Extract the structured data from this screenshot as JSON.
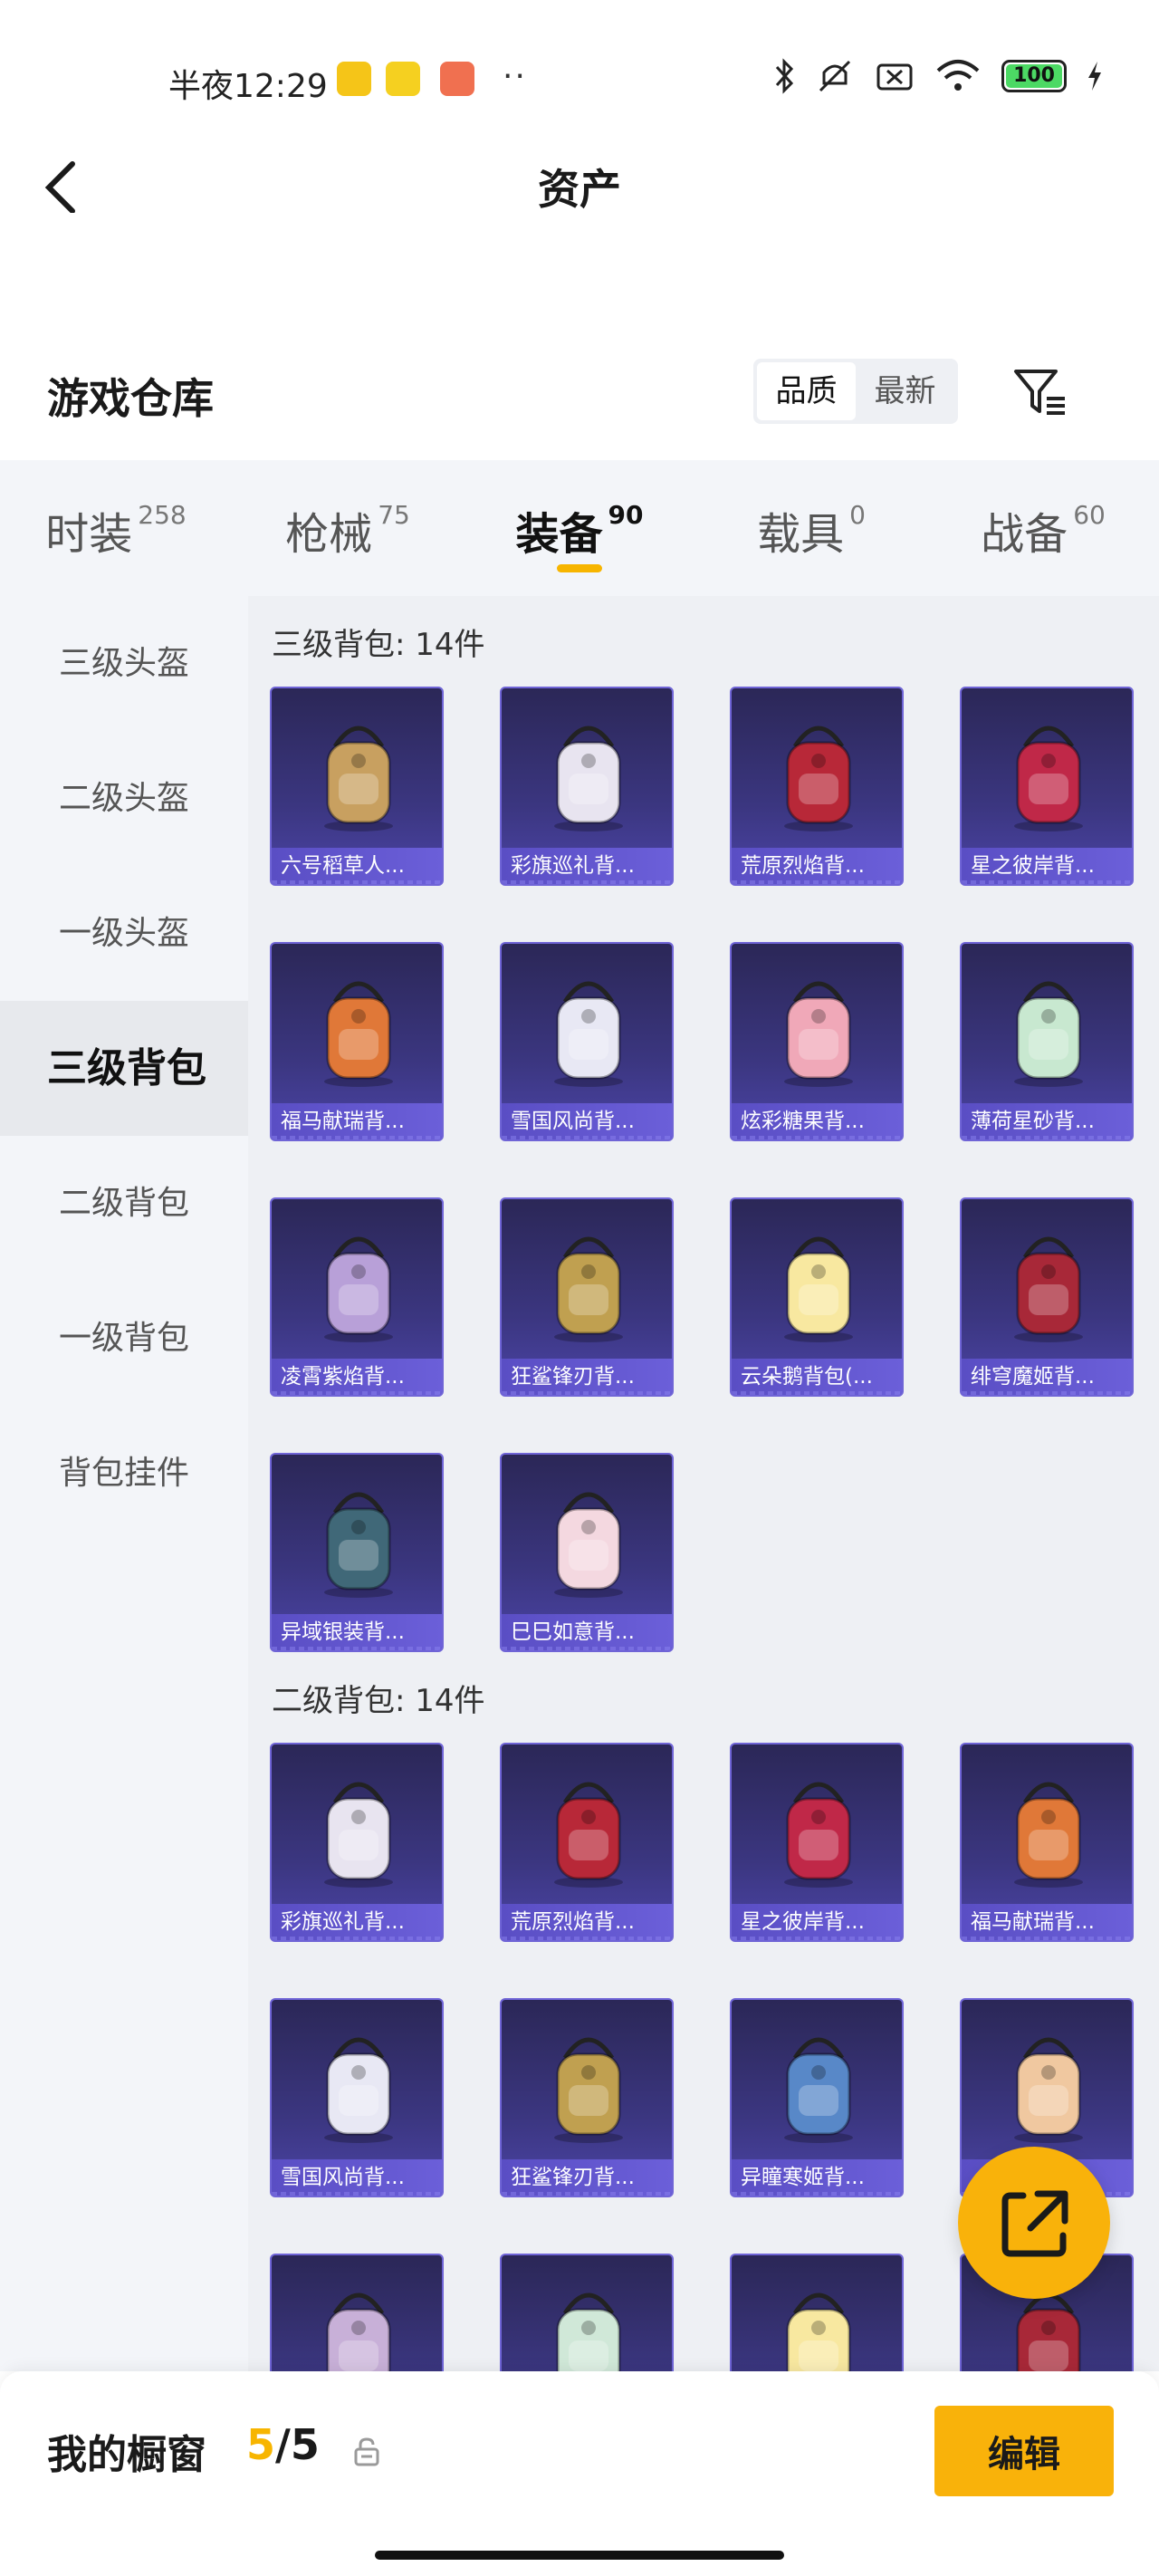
{
  "status_bar": {
    "time": "半夜12:29",
    "dots": "··",
    "battery": "100"
  },
  "nav": {
    "title": "资产"
  },
  "warehouse": {
    "title": "游戏仓库",
    "sort_options": [
      "品质",
      "最新"
    ],
    "active_sort": "品质"
  },
  "tabs": [
    {
      "label": "时装",
      "count": "258"
    },
    {
      "label": "枪械",
      "count": "75"
    },
    {
      "label": "装备",
      "count": "90",
      "active": true
    },
    {
      "label": "载具",
      "count": "0"
    },
    {
      "label": "战备",
      "count": "60"
    }
  ],
  "sidebar": {
    "items": [
      "三级头盔",
      "二级头盔",
      "一级头盔",
      "三级背包",
      "二级背包",
      "一级背包",
      "背包挂件"
    ],
    "active": "三级背包"
  },
  "sections": [
    {
      "title": "三级背包: 14件",
      "items": [
        {
          "name": "六号稻草人...",
          "color": "#c8a060"
        },
        {
          "name": "彩旗巡礼背...",
          "color": "#e8e4f0"
        },
        {
          "name": "荒原烈焰背...",
          "color": "#b82838"
        },
        {
          "name": "星之彼岸背...",
          "color": "#c02848"
        },
        {
          "name": "福马献瑞背...",
          "color": "#e07838"
        },
        {
          "name": "雪国风尚背...",
          "color": "#e8e8f4"
        },
        {
          "name": "炫彩糖果背...",
          "color": "#f0a8b8"
        },
        {
          "name": "薄荷星砂背...",
          "color": "#c8e8d0"
        },
        {
          "name": "凌霄紫焰背...",
          "color": "#b8a0d8"
        },
        {
          "name": "狂鲨锋刃背...",
          "color": "#c0a050"
        },
        {
          "name": "云朵鹅背包(...",
          "color": "#f8e8a0"
        },
        {
          "name": "绯穹魔姬背...",
          "color": "#a82838"
        },
        {
          "name": "异域银装背...",
          "color": "#406878"
        },
        {
          "name": "巳巳如意背...",
          "color": "#f4d8e0"
        }
      ]
    },
    {
      "title": "二级背包: 14件",
      "items": [
        {
          "name": "彩旗巡礼背...",
          "color": "#e8e4f0"
        },
        {
          "name": "荒原烈焰背...",
          "color": "#b82838"
        },
        {
          "name": "星之彼岸背...",
          "color": "#c02848"
        },
        {
          "name": "福马献瑞背...",
          "color": "#e07838"
        },
        {
          "name": "雪国风尚背...",
          "color": "#e8e8f4"
        },
        {
          "name": "狂鲨锋刃背...",
          "color": "#c0a050"
        },
        {
          "name": "异瞳寒姬背...",
          "color": "#5888c8"
        },
        {
          "name": "",
          "color": "#f0c8a0"
        },
        {
          "name": "",
          "color": "#c8b0d8"
        },
        {
          "name": "",
          "color": "#d0e8d8"
        },
        {
          "name": "",
          "color": "#f8e8a0"
        },
        {
          "name": "",
          "color": "#a82838"
        }
      ]
    }
  ],
  "bottom_bar": {
    "label": "我的橱窗",
    "current": "5",
    "separator": "/",
    "total": "5",
    "edit_label": "编辑"
  }
}
